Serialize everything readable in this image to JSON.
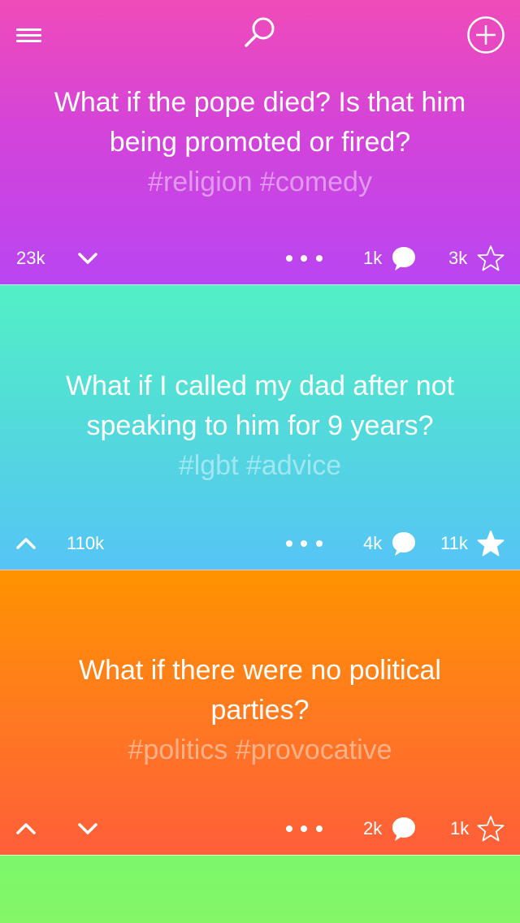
{
  "header": {
    "menu_icon": "hamburger-menu-icon",
    "search_icon": "search-icon",
    "add_icon": "plus-circle-icon"
  },
  "cards": [
    {
      "color_top": "#f04bb8",
      "color_bottom": "#b945f2",
      "question": "What if the pope died? Is that him being promoted or fired?",
      "tags": "#religion #comedy",
      "left_count": "23k",
      "comments": "1k",
      "favorites": "3k",
      "star_filled": false
    },
    {
      "color_top": "#52f0c6",
      "color_bottom": "#56c4f6",
      "question": "What if I called my dad after not speaking to him for 9 years?",
      "tags": "#lgbt #advice",
      "vote_count": "110k",
      "comments": "4k",
      "favorites": "11k",
      "star_filled": true
    },
    {
      "color_top": "#ff9300",
      "color_bottom": "#ff5e3a",
      "question": "What if there were no political parties?",
      "tags": "#politics #provocative",
      "comments": "2k",
      "favorites": "1k",
      "star_filled": false
    }
  ],
  "next_card_color": "#7bf76a"
}
